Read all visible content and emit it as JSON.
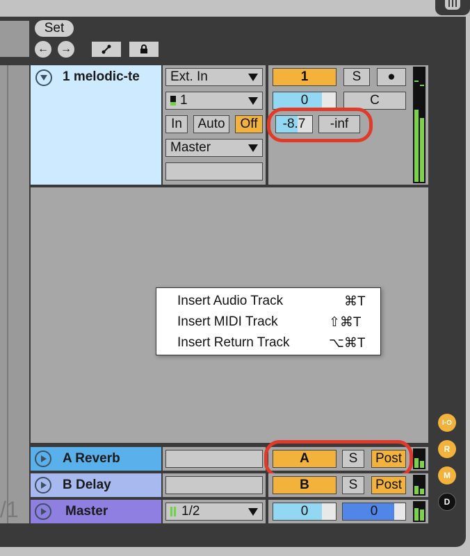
{
  "top": {
    "set_label": "Set"
  },
  "track1": {
    "name": "1 melodic-te",
    "input_type": "Ext. In",
    "input_channel": "1",
    "monitor": [
      "In",
      "Auto",
      "Off"
    ],
    "output": "Master",
    "track_number": "1",
    "solo": "S",
    "arm": "●",
    "volume": "0",
    "pan": "C",
    "volume_db": "-8.7",
    "peak": "-inf"
  },
  "context_menu": {
    "items": [
      {
        "label": "Insert Audio Track",
        "shortcut": "⌘T"
      },
      {
        "label": "Insert MIDI Track",
        "shortcut": "⇧⌘T"
      },
      {
        "label": "Insert Return Track",
        "shortcut": "⌥⌘T"
      }
    ]
  },
  "returns": [
    {
      "name": "A Reverb",
      "letter": "A",
      "solo": "S",
      "pre_post": "Post",
      "color": "#5ab0ea"
    },
    {
      "name": "B Delay",
      "letter": "B",
      "solo": "S",
      "pre_post": "Post",
      "color": "#a7b9ef"
    }
  ],
  "master": {
    "name": "Master",
    "cue_out": "1/2",
    "vol_a": "0",
    "vol_b": "0",
    "color": "#8e7fe0",
    "left_value": "/1"
  },
  "side_buttons": [
    "I·O",
    "R",
    "M",
    "D"
  ],
  "colors": {
    "accent_orange": "#f2b23c",
    "highlight_red": "#e03a2a",
    "track_bg": "#cdeaff"
  }
}
